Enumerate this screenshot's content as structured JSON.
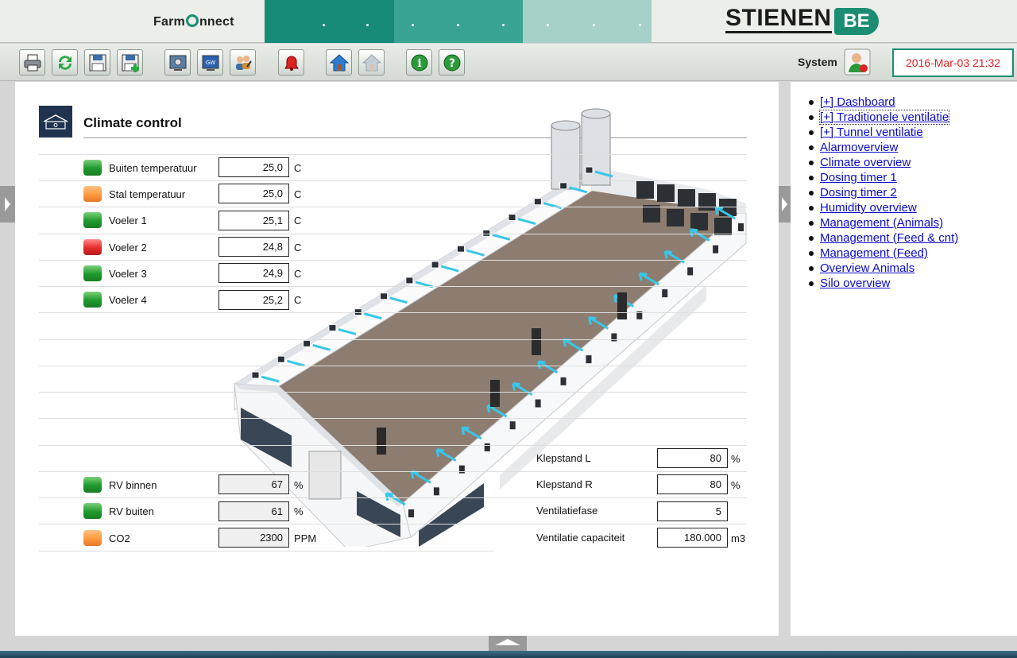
{
  "brand": {
    "farmconnect_left": "Farm",
    "farmconnect_right": "nnect",
    "stienen": "STIENEN",
    "be": "BE"
  },
  "colors": {
    "accent": "#1a8d73",
    "link": "#0b0bcc",
    "datetime": "#e02020",
    "led_green": "#1e9a2c",
    "led_orange": "#ff9a3c",
    "led_red": "#e52b2b"
  },
  "toolbar": {
    "buttons": [
      {
        "name": "printer-icon"
      },
      {
        "name": "refresh-icon"
      },
      {
        "name": "save-icon"
      },
      {
        "name": "save-as-icon"
      },
      {
        "name": "settings-screen-icon"
      },
      {
        "name": "gateway-icon"
      },
      {
        "name": "users-icon"
      },
      {
        "name": "alarm-bell-icon"
      },
      {
        "name": "home-icon"
      },
      {
        "name": "home-disabled-icon"
      },
      {
        "name": "info-icon"
      },
      {
        "name": "help-icon"
      }
    ],
    "user": "System",
    "datetime": "2016-Mar-03 21:32"
  },
  "main": {
    "title": "Climate control",
    "sensors": [
      {
        "label": "Buiten temperatuur",
        "value": "25,0",
        "unit": "C",
        "status": "green"
      },
      {
        "label": "Stal temperatuur",
        "value": "25,0",
        "unit": "C",
        "status": "orange"
      },
      {
        "label": "Voeler 1",
        "value": "25,1",
        "unit": "C",
        "status": "green"
      },
      {
        "label": "Voeler 2",
        "value": "24,8",
        "unit": "C",
        "status": "red"
      },
      {
        "label": "Voeler 3",
        "value": "24,9",
        "unit": "C",
        "status": "green"
      },
      {
        "label": "Voeler 4",
        "value": "25,2",
        "unit": "C",
        "status": "green"
      }
    ],
    "humidity": [
      {
        "label": "RV binnen",
        "value": "67",
        "unit": "%",
        "status": "green"
      },
      {
        "label": "RV buiten",
        "value": "61",
        "unit": "%",
        "status": "green"
      },
      {
        "label": "CO2",
        "value": "2300",
        "unit": "PPM",
        "status": "orange"
      }
    ],
    "ventilation": [
      {
        "label": "Klepstand L",
        "value": "80",
        "unit": "%"
      },
      {
        "label": "Klepstand R",
        "value": "80",
        "unit": "%"
      },
      {
        "label": "Ventilatiefase",
        "value": "5",
        "unit": ""
      },
      {
        "label": "Ventilatie capaciteit",
        "value": "180.000",
        "unit": "m3"
      }
    ]
  },
  "nav": {
    "items": [
      "[+] Dashboard",
      "[+] Traditionele ventilatie",
      "[+] Tunnel ventilatie",
      "Alarmoverview",
      "Climate overview",
      "Dosing timer 1",
      "Dosing timer 2",
      "Humidity overview",
      "Management (Animals)",
      "Management (Feed & cnt)",
      "Management (Feed)",
      "Overview Animals",
      "Silo overview"
    ]
  }
}
